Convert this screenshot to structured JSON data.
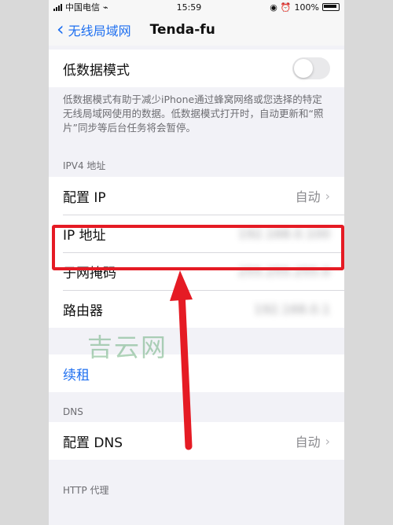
{
  "status_bar": {
    "carrier": "中国电信",
    "time": "15:59",
    "battery": "100%"
  },
  "nav": {
    "back_label": "无线局域网",
    "title": "Tenda-fu"
  },
  "low_data": {
    "label": "低数据模式",
    "description": "低数据模式有助于减少iPhone通过蜂窝网络或您选择的特定无线局域网使用的数据。低数据模式打开时，自动更新和“照片”同步等后台任务将会暂停。"
  },
  "ipv4": {
    "header": "IPV4 地址",
    "configure_ip_label": "配置 IP",
    "configure_ip_value": "自动",
    "ip_address_label": "IP 地址",
    "ip_address_value": "192.168.0.100",
    "subnet_label": "子网掩码",
    "subnet_value": "255.255.255.0",
    "router_label": "路由器",
    "router_value": "192.168.0.1"
  },
  "renew": {
    "label": "续租"
  },
  "dns": {
    "header": "DNS",
    "configure_dns_label": "配置 DNS",
    "configure_dns_value": "自动"
  },
  "http_proxy": {
    "header": "HTTP 代理"
  },
  "watermark": {
    "text": "吉云网"
  },
  "colors": {
    "accent": "#1e6ff0",
    "annotation_red": "#e51b24"
  }
}
